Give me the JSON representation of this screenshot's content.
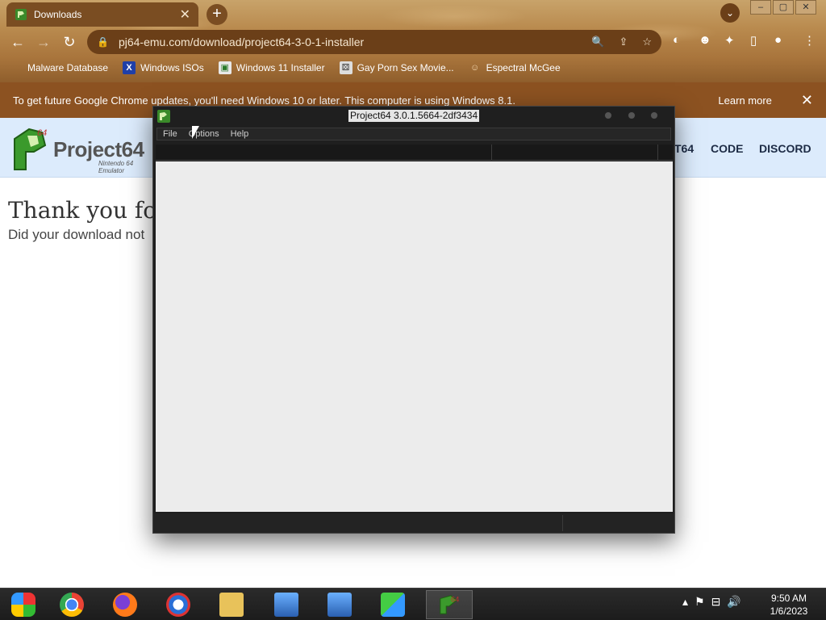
{
  "browser": {
    "tab_title": "Downloads",
    "tab_close": "✕",
    "new_tab": "+",
    "url": "pj64-emu.com/download/project64-3-0-1-installer",
    "bookmarks": [
      {
        "label": "Malware Database"
      },
      {
        "label": "Windows ISOs"
      },
      {
        "label": "Windows 11 Installer"
      },
      {
        "label": "Gay Porn Sex Movie..."
      },
      {
        "label": "Espectral McGee"
      }
    ]
  },
  "infobar": {
    "message": "To get future Google Chrome updates, you'll need Windows 10 or later. This computer is using Windows 8.1.",
    "learn_more": "Learn more"
  },
  "site": {
    "logo_text": "Project64",
    "logo_sub": "Nintendo 64 Emulator",
    "nav": [
      "T64",
      "CODE",
      "DISCORD"
    ],
    "hero_title": "Thank you fo",
    "hero_sub": "Did your download not"
  },
  "pj_window": {
    "title": "Project64 3.0.1.5664-2df3434",
    "menu": [
      "File",
      "Options",
      "Help"
    ]
  },
  "taskbar": {
    "time": "9:50 AM",
    "date": "1/6/2023"
  },
  "colors": {
    "chrome_theme": "#8c5221",
    "site_header_bg": "#dcebfc",
    "pj_content_bg": "#ececec",
    "taskbar_bg": "#1c1c1c"
  }
}
